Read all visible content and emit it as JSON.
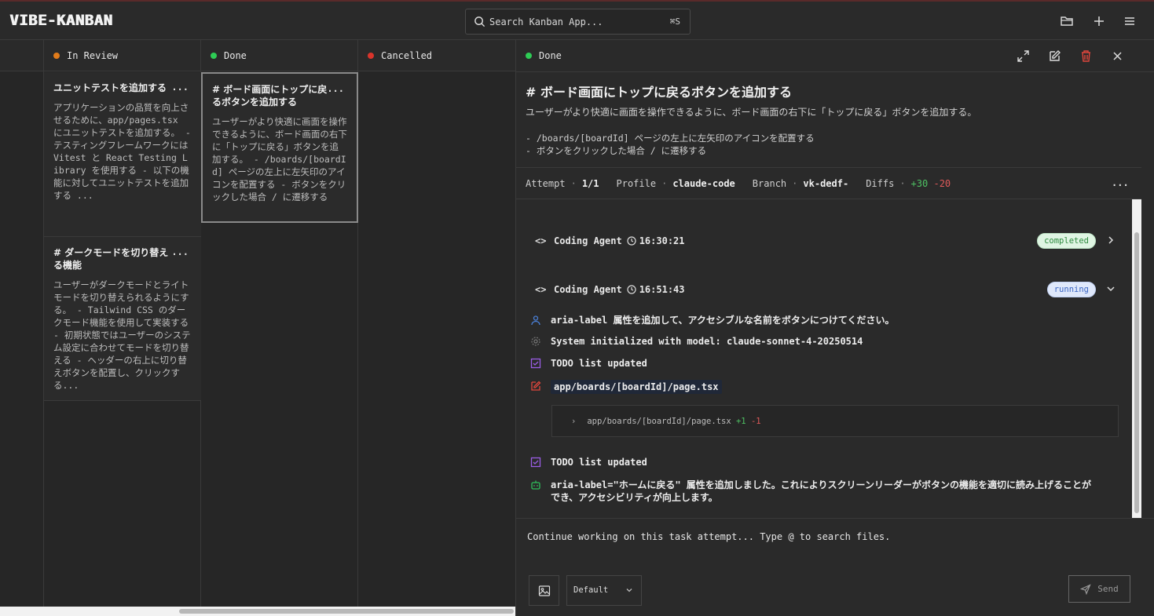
{
  "app": {
    "logo": "VIBE-KANBAN",
    "search_placeholder": "Search Kanban App...",
    "search_shortcut": "⌘S"
  },
  "columns": [
    {
      "name": "In Review",
      "dot_color": "#e07b1a",
      "cards": [
        {
          "title": "ユニットテストを追加する",
          "description": "アプリケーションの品質を向上させるために、app/pages.tsx にユニットテストを追加する。 - テスティングフレームワークには Vitest と React Testing Library を使用する - 以下の機能に対してユニットテストを追加する ..."
        },
        {
          "title": "# ダークモードを切り替える機能",
          "description": "ユーザーがダークモードとライトモードを切り替えられるようにする。 - Tailwind CSS のダークモード機能を使用して実装する - 初期状態ではユーザーのシステム設定に合わせてモードを切り替える - ヘッダーの右上に切り替えボタンを配置し、クリックする..."
        }
      ]
    },
    {
      "name": "Done",
      "dot_color": "#2ecc55",
      "cards": [
        {
          "title": "# ボード画面にトップに戻るボタンを追加する",
          "description": "ユーザーがより快適に画面を操作できるように、ボード画面の右下に「トップに戻る」ボタンを追加する。 - /boards/[boardId] ページの左上に左矢印のアイコンを配置する - ボタンをクリックした場合 / に遷移する"
        }
      ]
    },
    {
      "name": "Cancelled",
      "dot_color": "#d9342b",
      "cards": []
    }
  ],
  "card_more_label": "...",
  "panel": {
    "status": "Done",
    "status_color": "#2ecc55",
    "title": "# ボード画面にトップに戻るボタンを追加する",
    "description": "ユーザーがより快適に画面を操作できるように、ボード画面の右下に「トップに戻る」ボタンを追加する。",
    "bullets": [
      "- /boards/[boardId] ページの左上に左矢印のアイコンを配置する",
      "- ボタンをクリックした場合 / に遷移する"
    ],
    "meta": {
      "attempt_label": "Attempt",
      "attempt_value": "1/1",
      "profile_label": "Profile",
      "profile_value": "claude-code",
      "branch_label": "Branch",
      "branch_value": "vk-dedf-",
      "diffs_label": "Diffs",
      "diffs_added": "+30",
      "diffs_removed": "-20",
      "sep": "·",
      "more": "..."
    },
    "log": {
      "processes": [
        {
          "label": "Coding Agent",
          "time": "16:30:21",
          "status": "completed"
        },
        {
          "label": "Coding Agent",
          "time": "16:51:43",
          "status": "running"
        }
      ],
      "entries": [
        {
          "icon": "user-icon",
          "text": "aria-label 属性を追加して、アクセシブルな名前をボタンにつけてください。"
        },
        {
          "icon": "gear-icon",
          "text": "System initialized with model: claude-sonnet-4-20250514"
        },
        {
          "icon": "checkbox-icon",
          "text": "TODO list updated"
        },
        {
          "icon": "edit-icon",
          "text": "app/boards/[boardId]/page.tsx"
        },
        {
          "icon": "checkbox-icon",
          "text": "TODO list updated"
        },
        {
          "icon": "bot-icon",
          "text": "aria-label=\"ホームに戻る\" 属性を追加しました。これによりスクリーンリーダーがボタンの機能を適切に読み上げることができ、アクセシビリティが向上します。"
        }
      ],
      "diff": {
        "file": "app/boards/[boardId]/page.tsx",
        "added": "+1",
        "removed": "-1"
      }
    },
    "composer": {
      "placeholder": "Continue working on this task attempt... Type @ to search files.",
      "profile": "Default",
      "send_label": "Send"
    }
  },
  "colors": {
    "accent_green": "#4ec163",
    "accent_red": "#e05a5a",
    "icon_user": "#4a7fd6",
    "icon_todo": "#9b5de5",
    "icon_edit": "#e0463c",
    "icon_bot": "#2fbf5a"
  }
}
